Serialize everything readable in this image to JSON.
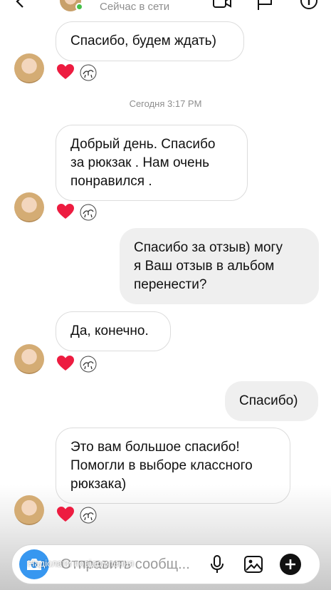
{
  "header": {
    "status": "Сейчас в сети",
    "online_color": "#44c04a",
    "icons": [
      "back-icon",
      "video-call-icon",
      "flag-icon",
      "info-icon"
    ]
  },
  "timestamp": "Сегодня 3:17 PM",
  "messages": [
    {
      "direction": "incoming",
      "text": "Спасибо, будем ждать)"
    },
    {
      "direction": "incoming",
      "text": "Добрый день. Спасибо\nза рюкзак . Нам очень\nпонравился ."
    },
    {
      "direction": "outgoing",
      "text": "Спасибо за отзыв) могу\nя Ваш отзыв в альбом\nперенести?"
    },
    {
      "direction": "incoming",
      "text": "Да, конечно."
    },
    {
      "direction": "outgoing",
      "text": "Спасибо)"
    },
    {
      "direction": "incoming",
      "text": "Это вам большое спасибо!\nПомогли в выборе классного\nрюкзака)"
    }
  ],
  "reactions": {
    "heart_color": "#ed1c40",
    "icons": [
      "heart-icon",
      "sticker-icon"
    ]
  },
  "composer": {
    "placeholder": "Отправить сообщ...",
    "overlay_hint": "Надіслати повідомлення",
    "accent": "#3797f0"
  }
}
